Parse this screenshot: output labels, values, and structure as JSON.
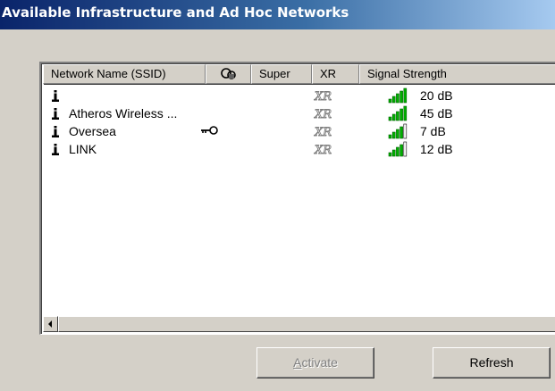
{
  "window": {
    "title": "Available Infrastructure and Ad Hoc Networks"
  },
  "columns": [
    {
      "label": "Network Name (SSID)"
    },
    {
      "label": "",
      "icon": "security-lock-icon"
    },
    {
      "label": "Super"
    },
    {
      "label": "XR"
    },
    {
      "label": "Signal Strength"
    }
  ],
  "networks": [
    {
      "ssid": "",
      "secured": false,
      "xr_icon": "xr-icon",
      "signal": "20 dB",
      "bars": 5
    },
    {
      "ssid": "Atheros Wireless ...",
      "secured": false,
      "xr_icon": "xr-icon",
      "signal": "45 dB",
      "bars": 5
    },
    {
      "ssid": "Oversea",
      "secured": true,
      "xr_icon": "xr-icon",
      "signal": "7 dB",
      "bars": 4
    },
    {
      "ssid": "LINK",
      "secured": false,
      "xr_icon": "xr-icon",
      "signal": "12 dB",
      "bars": 4
    }
  ],
  "buttons": {
    "activate_prefix": "A",
    "activate_rest": "ctivate",
    "refresh": "Refresh"
  },
  "colors": {
    "signal_bar": "#00b000",
    "title_gradient_start": "#0a246a",
    "title_gradient_end": "#a6caf0"
  }
}
